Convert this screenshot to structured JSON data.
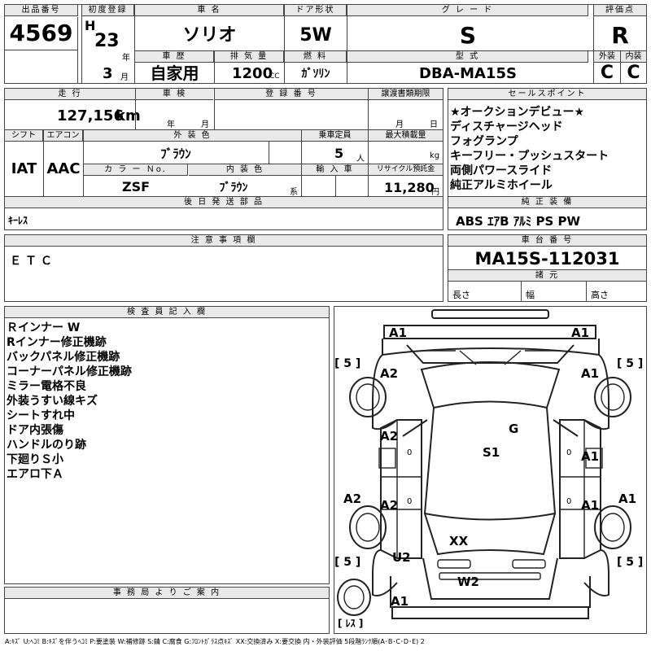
{
  "header": {
    "lot_label": "出品番号",
    "lot": "4569",
    "first_reg_label": "初度登録",
    "era": "H",
    "year": "23",
    "year_unit": "年",
    "month": "3",
    "month_unit": "月",
    "name_label": "車 名",
    "name": "ソリオ",
    "door_label": "ドア形状",
    "door": "5W",
    "grade_label": "グ レ ー ド",
    "grade": "S",
    "score_label": "評価点",
    "score": "R",
    "history_label": "車 歴",
    "history": "自家用",
    "displacement_label": "排 気 量",
    "displacement": "1200",
    "cc": "CC",
    "fuel_label": "燃 料",
    "fuel": "ｶﾞｿﾘﾝ",
    "model_label": "型 式",
    "model": "DBA-MA15S",
    "exterior_label": "外装",
    "exterior": "C",
    "interior_label": "内装",
    "interior": "C"
  },
  "row2": {
    "mileage_label": "走 行",
    "mileage": "127,156",
    "km": "km",
    "inspection_label": "車 検",
    "insp_year": "年",
    "insp_month": "月",
    "plate_label": "登 録 番 号",
    "transfer_label": "譲渡書類期限",
    "tr_month": "月",
    "tr_day": "日",
    "shift_label": "シフト",
    "shift": "IAT",
    "ac_label": "エアコン",
    "ac": "AAC",
    "color_label": "外 装 色",
    "color": "ﾌﾞﾗｳﾝ",
    "capacity_label": "乗車定員",
    "capacity": "5",
    "person": "人",
    "load_label": "最大積載量",
    "kg": "kg",
    "colorno_label": "カ ラ ー Ｎo.",
    "colorno": "ZSF",
    "intcolor_label": "内 装 色",
    "intcolor": "ﾌﾞﾗｳﾝ",
    "kei": "系",
    "import_label": "輸 入 車",
    "recycle_label": "リサイクル預託金",
    "recycle": "11,280",
    "yen": "円",
    "parts_label": "後 日 発 送 部 品",
    "parts": "ｷｰﾚｽ"
  },
  "sales": {
    "label": "セールスポイント",
    "items": [
      "★オークションデビュー★",
      "ディスチャージヘッド",
      "フォグランプ",
      "キーフリー・プッシュスタート",
      "両側パワースライド",
      "純正アルミホイール"
    ]
  },
  "equip": {
    "label": "純 正 装 備",
    "value": "ABS ｴｱB ｱﾙﾐ PS PW"
  },
  "caution": {
    "label": "注 意 事 項 欄",
    "value": "ＥＴＣ"
  },
  "chassis": {
    "label": "車 台 番 号",
    "value": "MA15S-112031"
  },
  "specs": {
    "label": "諸 元",
    "length": "長さ",
    "width": "幅",
    "height": "高さ"
  },
  "inspector": {
    "label": "検 査 員 記 入 欄",
    "notes": [
      "Ｒインナー W",
      "Rインナー修正機跡",
      "バックパネル修正機跡",
      "コーナーパネル修正機跡",
      "ミラー電格不良",
      "外装うすい線キズ",
      "シートすれ中",
      "ドア内張傷",
      "ハンドルのり跡",
      "下廻りＳ小",
      "エアロ下Ａ"
    ]
  },
  "office": {
    "label": "事 務 局 よ り ご 案 内"
  },
  "diagram": {
    "grades": {
      "a1_front_left": "A1",
      "a1_front_right": "A1",
      "a2_left_front": "A2",
      "a1_right_front": "A1",
      "g": "G",
      "a2_left_door": "A2",
      "s1": "S1",
      "a1_right_door": "A1",
      "a2_left_side": "A2",
      "a2_left_rear_door": "A2",
      "a1_right_rear_door": "A1",
      "a1_right_side": "A1",
      "xx": "XX",
      "u2": "U2",
      "w2": "W2",
      "a1_rear_left": "A1"
    },
    "tires": [
      "[ 5 ]",
      "[ 5 ]",
      "[ 5 ]",
      "[ 5 ]"
    ],
    "spare": "[ ﾚｽ ]",
    "door_marks": [
      "0",
      "0",
      "0",
      "0"
    ]
  },
  "legend": "A:ｷｽﾞ U:ﾍｺﾐ B:ｷｽﾞを伴うﾍｺﾐ P:要塗装 W:補修跡 S:錆 C:腐食 G:ﾌﾛﾝﾄｶﾞﾗｽ点ｷｽﾞ XX:交換済み X:要交換 内・外装評価 5段階ﾗﾝｸ順(A･B･C･D･E) 2"
}
